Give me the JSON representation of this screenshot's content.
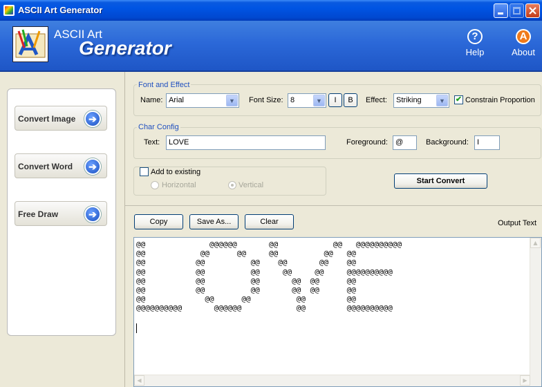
{
  "window": {
    "title": "ASCII Art Generator"
  },
  "header": {
    "brand_top": "ASCII Art",
    "brand_main": "Generator",
    "help_label": "Help",
    "help_glyph": "?",
    "about_label": "About",
    "about_glyph": "A"
  },
  "nav": {
    "items": [
      {
        "label": "Convert Image"
      },
      {
        "label": "Convert Word"
      },
      {
        "label": "Free Draw"
      }
    ],
    "arrow_glyph": "➔"
  },
  "font_effect": {
    "legend": "Font and Effect",
    "name_label": "Name:",
    "name_value": "Arial",
    "size_label": "Font Size:",
    "size_value": "8",
    "italic_label": "I",
    "bold_label": "B",
    "effect_label": "Effect:",
    "effect_value": "Striking",
    "constrain_label": "Constrain Proportion",
    "constrain_checked": true
  },
  "char_config": {
    "legend": "Char Config",
    "text_label": "Text:",
    "text_value": "LOVE",
    "fg_label": "Foreground:",
    "fg_value": "@",
    "bg_label": "Background:",
    "bg_value": "I"
  },
  "add_existing": {
    "label": "Add to existing",
    "checked": false,
    "horizontal_label": "Horizontal",
    "vertical_label": "Vertical",
    "selected": "Vertical"
  },
  "actions": {
    "start_convert": "Start Convert",
    "copy": "Copy",
    "save_as": "Save As...",
    "clear": "Clear"
  },
  "output": {
    "label": "Output Text",
    "text": "@@              @@@@@@       @@            @@   @@@@@@@@@@\n@@            @@      @@     @@          @@   @@\n@@           @@          @@    @@       @@    @@\n@@           @@          @@     @@     @@     @@@@@@@@@@\n@@           @@          @@       @@  @@      @@\n@@           @@          @@       @@  @@      @@\n@@             @@      @@          @@         @@\n@@@@@@@@@@       @@@@@@            @@         @@@@@@@@@@"
  },
  "colors": {
    "title_bar": "#0054e3",
    "header_bg": "#2b68d8",
    "window_bg": "#ece9d8",
    "legend_text": "#1f4fbf"
  }
}
